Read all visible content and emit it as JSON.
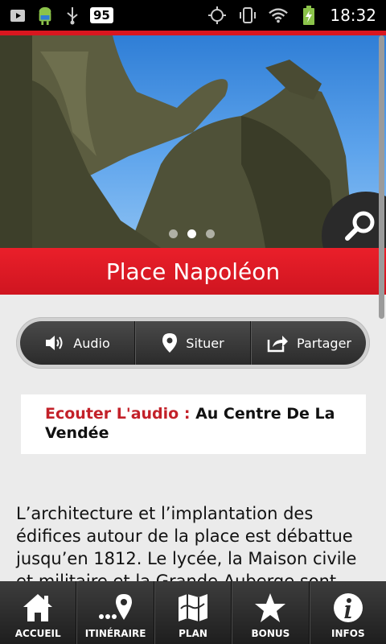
{
  "status_bar": {
    "battery_level": "95",
    "time": "18:32",
    "icons": [
      "screenshot-icon",
      "android-icon",
      "usb-icon",
      "gps-icon",
      "vibrate-icon",
      "wifi-icon",
      "battery-charging-icon"
    ]
  },
  "hero": {
    "image": "equestrian statue of Napoleon against blue sky",
    "carousel_dots": 3,
    "active_dot": 1,
    "search_icon": "search-icon"
  },
  "title": "Place Napoléon",
  "actions": [
    {
      "label": "Audio",
      "icon": "speaker-icon"
    },
    {
      "label": "Situer",
      "icon": "location-pin-icon"
    },
    {
      "label": "Partager",
      "icon": "share-icon"
    }
  ],
  "audio": {
    "label": "Ecouter L'audio :",
    "title": "Au Centre De La Vendée"
  },
  "body_text": "L’architecture et l’implantation des édifices autour de la place est débattue jusqu’en 1812. Le lycée, la Maison civile et militaire et la Grande Auberge sont",
  "bottom_nav": [
    {
      "label": "ACCUEIL",
      "icon": "home-icon"
    },
    {
      "label": "ITINÉRAIRE",
      "icon": "route-icon"
    },
    {
      "label": "PLAN",
      "icon": "map-icon"
    },
    {
      "label": "BONUS",
      "icon": "star-icon"
    },
    {
      "label": "INFOS",
      "icon": "info-icon"
    }
  ],
  "colors": {
    "accent": "#d9161f",
    "audio_label": "#c32129",
    "background": "#ebebeb"
  }
}
